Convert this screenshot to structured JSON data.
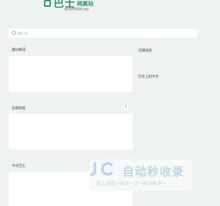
{
  "header": {
    "logo_big": "巴士",
    "logo_small": "档案站",
    "logo_domain": "BUSPEDIA.top"
  },
  "search": {
    "placeholder": "搜索公交"
  },
  "sections": {
    "fleet_news": "爆炒新闻",
    "recent_updates": "近期动态",
    "history_today": "历史上的今天",
    "recent_hot": "近期热度",
    "today_bus": "今日巴士"
  },
  "controls": {
    "hot_refresh_icon": "⇕"
  },
  "watermark": {
    "title": "自动秒收录",
    "subtitle": "致上链接→来访一次→自动收录→"
  }
}
